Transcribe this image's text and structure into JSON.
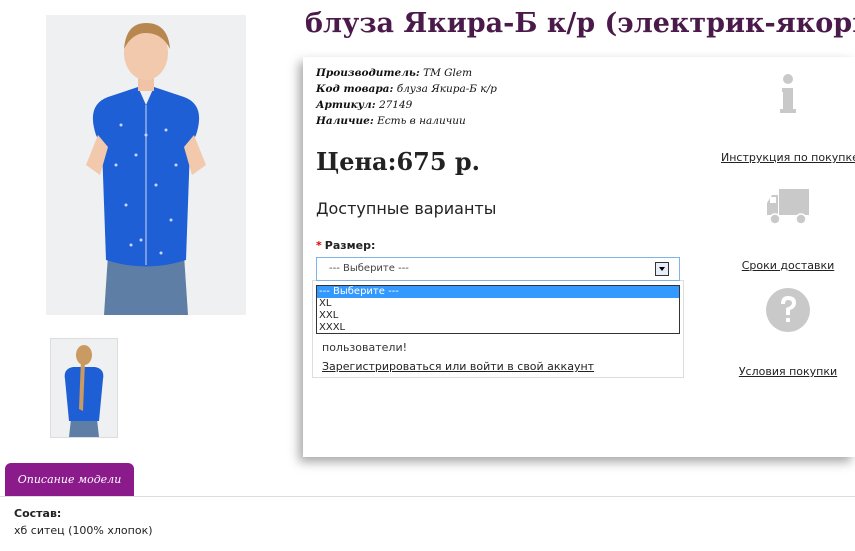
{
  "product": {
    "title": "блуза Якира-Б к/р (электрик-якорь)",
    "props": [
      {
        "label": "Производитель:",
        "value": "TM Glem"
      },
      {
        "label": "Код товара:",
        "value": "блуза Якира-Б к/р"
      },
      {
        "label": "Артикул:",
        "value": "27149"
      },
      {
        "label": "Наличие:",
        "value": "Есть в наличии"
      }
    ],
    "price": "Цена:675 р."
  },
  "options": {
    "heading": "Доступные варианты",
    "required_mark": "*",
    "size_label": "Размер:",
    "selected": "--- Выберите ---",
    "dropdown": [
      "--- Выберите ---",
      "XL",
      "XXL",
      "XXXL"
    ]
  },
  "login": {
    "text": "пользователи!",
    "link": "Зарегистрироваться или войти в свой аккаунт"
  },
  "sidebar": {
    "items": [
      {
        "label": "Инструкция по покупке",
        "icon": "info-icon"
      },
      {
        "label": "Сроки доставки",
        "icon": "truck-icon"
      },
      {
        "label": "Условия покупки",
        "icon": "question-icon"
      }
    ]
  },
  "tabs": {
    "description": "Описание модели"
  },
  "description": {
    "composition_label": "Состав:",
    "composition_value": "хб ситец (100% хлопок)"
  },
  "colors": {
    "title": "#4a1a4a",
    "tab": "#8b1a8b",
    "blouse": "#1f5fd6",
    "select_border": "#7eb4ea",
    "selected_option": "#3399ff"
  }
}
